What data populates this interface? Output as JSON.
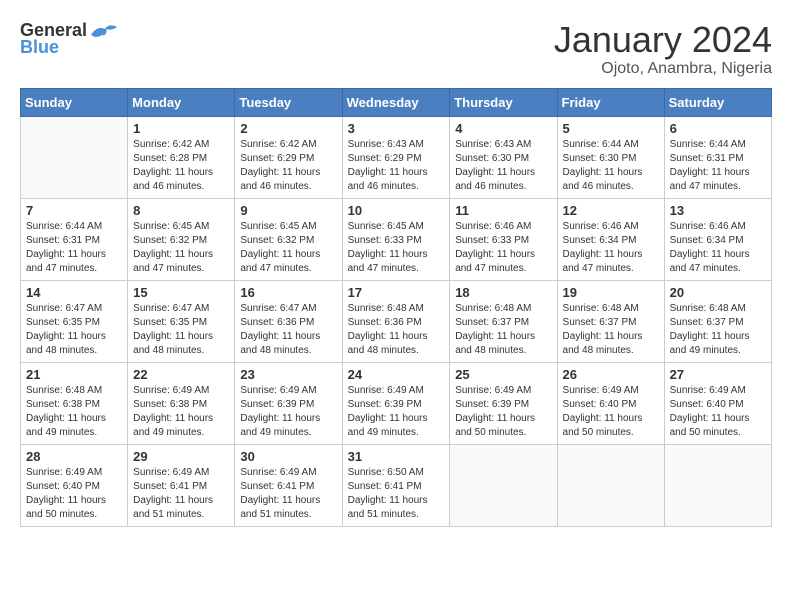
{
  "header": {
    "logo_general": "General",
    "logo_blue": "Blue",
    "month_year": "January 2024",
    "location": "Ojoto, Anambra, Nigeria"
  },
  "weekdays": [
    "Sunday",
    "Monday",
    "Tuesday",
    "Wednesday",
    "Thursday",
    "Friday",
    "Saturday"
  ],
  "weeks": [
    [
      {
        "day": "",
        "info": ""
      },
      {
        "day": "1",
        "info": "Sunrise: 6:42 AM\nSunset: 6:28 PM\nDaylight: 11 hours\nand 46 minutes."
      },
      {
        "day": "2",
        "info": "Sunrise: 6:42 AM\nSunset: 6:29 PM\nDaylight: 11 hours\nand 46 minutes."
      },
      {
        "day": "3",
        "info": "Sunrise: 6:43 AM\nSunset: 6:29 PM\nDaylight: 11 hours\nand 46 minutes."
      },
      {
        "day": "4",
        "info": "Sunrise: 6:43 AM\nSunset: 6:30 PM\nDaylight: 11 hours\nand 46 minutes."
      },
      {
        "day": "5",
        "info": "Sunrise: 6:44 AM\nSunset: 6:30 PM\nDaylight: 11 hours\nand 46 minutes."
      },
      {
        "day": "6",
        "info": "Sunrise: 6:44 AM\nSunset: 6:31 PM\nDaylight: 11 hours\nand 47 minutes."
      }
    ],
    [
      {
        "day": "7",
        "info": "Sunrise: 6:44 AM\nSunset: 6:31 PM\nDaylight: 11 hours\nand 47 minutes."
      },
      {
        "day": "8",
        "info": "Sunrise: 6:45 AM\nSunset: 6:32 PM\nDaylight: 11 hours\nand 47 minutes."
      },
      {
        "day": "9",
        "info": "Sunrise: 6:45 AM\nSunset: 6:32 PM\nDaylight: 11 hours\nand 47 minutes."
      },
      {
        "day": "10",
        "info": "Sunrise: 6:45 AM\nSunset: 6:33 PM\nDaylight: 11 hours\nand 47 minutes."
      },
      {
        "day": "11",
        "info": "Sunrise: 6:46 AM\nSunset: 6:33 PM\nDaylight: 11 hours\nand 47 minutes."
      },
      {
        "day": "12",
        "info": "Sunrise: 6:46 AM\nSunset: 6:34 PM\nDaylight: 11 hours\nand 47 minutes."
      },
      {
        "day": "13",
        "info": "Sunrise: 6:46 AM\nSunset: 6:34 PM\nDaylight: 11 hours\nand 47 minutes."
      }
    ],
    [
      {
        "day": "14",
        "info": "Sunrise: 6:47 AM\nSunset: 6:35 PM\nDaylight: 11 hours\nand 48 minutes."
      },
      {
        "day": "15",
        "info": "Sunrise: 6:47 AM\nSunset: 6:35 PM\nDaylight: 11 hours\nand 48 minutes."
      },
      {
        "day": "16",
        "info": "Sunrise: 6:47 AM\nSunset: 6:36 PM\nDaylight: 11 hours\nand 48 minutes."
      },
      {
        "day": "17",
        "info": "Sunrise: 6:48 AM\nSunset: 6:36 PM\nDaylight: 11 hours\nand 48 minutes."
      },
      {
        "day": "18",
        "info": "Sunrise: 6:48 AM\nSunset: 6:37 PM\nDaylight: 11 hours\nand 48 minutes."
      },
      {
        "day": "19",
        "info": "Sunrise: 6:48 AM\nSunset: 6:37 PM\nDaylight: 11 hours\nand 48 minutes."
      },
      {
        "day": "20",
        "info": "Sunrise: 6:48 AM\nSunset: 6:37 PM\nDaylight: 11 hours\nand 49 minutes."
      }
    ],
    [
      {
        "day": "21",
        "info": "Sunrise: 6:48 AM\nSunset: 6:38 PM\nDaylight: 11 hours\nand 49 minutes."
      },
      {
        "day": "22",
        "info": "Sunrise: 6:49 AM\nSunset: 6:38 PM\nDaylight: 11 hours\nand 49 minutes."
      },
      {
        "day": "23",
        "info": "Sunrise: 6:49 AM\nSunset: 6:39 PM\nDaylight: 11 hours\nand 49 minutes."
      },
      {
        "day": "24",
        "info": "Sunrise: 6:49 AM\nSunset: 6:39 PM\nDaylight: 11 hours\nand 49 minutes."
      },
      {
        "day": "25",
        "info": "Sunrise: 6:49 AM\nSunset: 6:39 PM\nDaylight: 11 hours\nand 50 minutes."
      },
      {
        "day": "26",
        "info": "Sunrise: 6:49 AM\nSunset: 6:40 PM\nDaylight: 11 hours\nand 50 minutes."
      },
      {
        "day": "27",
        "info": "Sunrise: 6:49 AM\nSunset: 6:40 PM\nDaylight: 11 hours\nand 50 minutes."
      }
    ],
    [
      {
        "day": "28",
        "info": "Sunrise: 6:49 AM\nSunset: 6:40 PM\nDaylight: 11 hours\nand 50 minutes."
      },
      {
        "day": "29",
        "info": "Sunrise: 6:49 AM\nSunset: 6:41 PM\nDaylight: 11 hours\nand 51 minutes."
      },
      {
        "day": "30",
        "info": "Sunrise: 6:49 AM\nSunset: 6:41 PM\nDaylight: 11 hours\nand 51 minutes."
      },
      {
        "day": "31",
        "info": "Sunrise: 6:50 AM\nSunset: 6:41 PM\nDaylight: 11 hours\nand 51 minutes."
      },
      {
        "day": "",
        "info": ""
      },
      {
        "day": "",
        "info": ""
      },
      {
        "day": "",
        "info": ""
      }
    ]
  ]
}
